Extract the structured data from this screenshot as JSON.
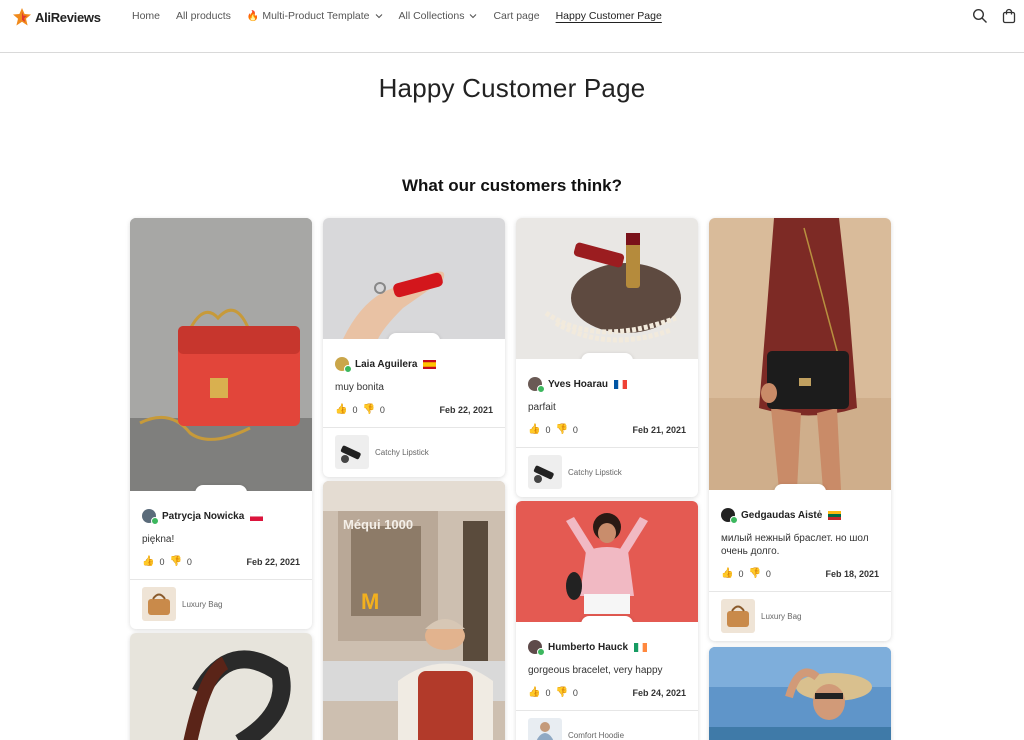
{
  "header": {
    "logo_text": "AliReviews",
    "nav": [
      {
        "label": "Home"
      },
      {
        "label": "All products"
      },
      {
        "label": "Multi-Product Template"
      },
      {
        "label": "All Collections"
      },
      {
        "label": "Cart page"
      },
      {
        "label": "Happy Customer Page"
      }
    ],
    "icons": [
      "search-icon",
      "cart-icon"
    ]
  },
  "page_title": "Happy Customer Page",
  "section_title": "What our customers think?",
  "colors": {
    "heart": "#f0a500",
    "verified": "#3cb75e",
    "accent": "#e0781a"
  },
  "rating_hearts": "♥♥♥♥♥",
  "reviews": [
    {
      "name": "Patrycja Nowicka",
      "text": "piękna!",
      "likes": "0",
      "dislikes": "0",
      "date": "Feb 22, 2021",
      "product": "Luxury Bag",
      "flag": "Poland"
    },
    {
      "name": "Laia Aguilera",
      "text": "muy bonita",
      "likes": "0",
      "dislikes": "0",
      "date": "Feb 22, 2021",
      "product": "Catchy Lipstick",
      "flag": "Spain"
    },
    {
      "name": "Yves Hoarau",
      "text": "parfait",
      "likes": "0",
      "dislikes": "0",
      "date": "Feb 21, 2021",
      "product": "Catchy Lipstick",
      "flag": "France"
    },
    {
      "name": "Gedgaudas Aistė",
      "text": "милый нежный браслет. но шол очень долго.",
      "likes": "0",
      "dislikes": "0",
      "date": "Feb 18, 2021",
      "product": "Luxury Bag",
      "flag": "Lithuania"
    },
    {
      "name": "Humberto Hauck",
      "text": "gorgeous bracelet, very happy",
      "likes": "0",
      "dislikes": "0",
      "date": "Feb 24, 2021",
      "product": "Comfort Hoodie",
      "flag": "Ireland"
    }
  ]
}
